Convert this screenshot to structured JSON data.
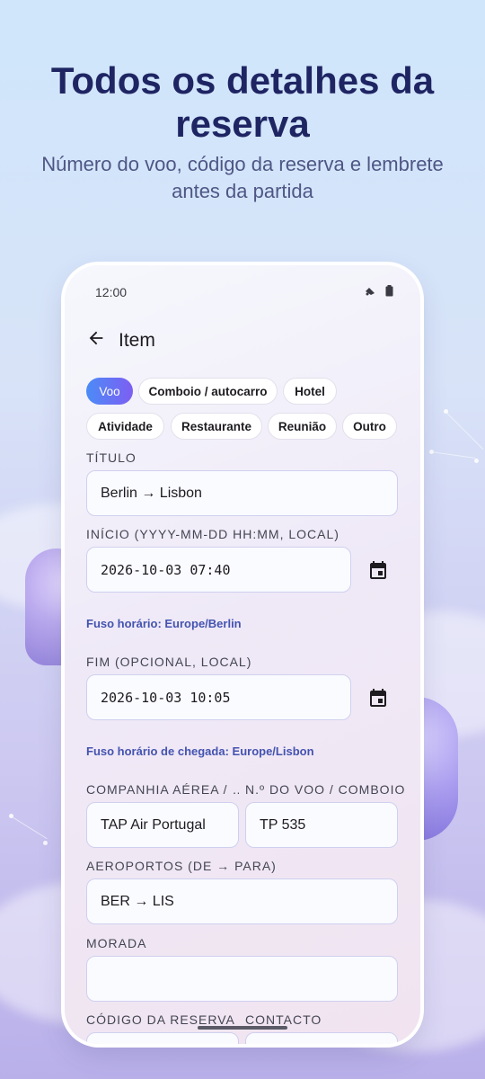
{
  "promo": {
    "headline": "Todos os detalhes da reserva",
    "subline": "Número do voo, código da reserva e lembrete antes da partida"
  },
  "status_bar": {
    "time": "12:00",
    "icons": [
      "signal-icon",
      "battery-icon"
    ]
  },
  "app_bar": {
    "back_icon": "arrow-back-icon",
    "title": "Item"
  },
  "categories": {
    "selected": "Voo",
    "items": [
      "Voo",
      "Comboio / autocarro",
      "Hotel",
      "Atividade",
      "Restaurante",
      "Reunião",
      "Outro"
    ]
  },
  "form": {
    "title": {
      "label": "TÍTULO",
      "value": "Berlin → Lisbon"
    },
    "start": {
      "label": "INÍCIO (YYYY-MM-DD HH:MM, LOCAL)",
      "value": "2026-10-03 07:40",
      "timezone": "Fuso horário: Europe/Berlin",
      "picker_icon": "calendar-icon"
    },
    "end": {
      "label": "FIM (OPCIONAL, LOCAL)",
      "value": "2026-10-03 10:05",
      "timezone": "Fuso horário de chegada: Europe/Lisbon",
      "picker_icon": "calendar-icon"
    },
    "airline": {
      "label": "COMPANHIA AÉREA / …",
      "value": "TAP Air Portugal"
    },
    "flight_number": {
      "label": "N.º DO VOO / COMBOIO",
      "value": "TP 535"
    },
    "airports": {
      "label": "AEROPORTOS (DE → PARA)",
      "value": "BER → LIS"
    },
    "address": {
      "label": "MORADA",
      "value": ""
    },
    "booking_code": {
      "label": "CÓDIGO DA RESERVA",
      "value": ""
    },
    "contact": {
      "label": "CONTACTO",
      "value": ""
    }
  },
  "colors": {
    "headline": "#1f2563",
    "accent_gradient_start": "#4b8cf7",
    "accent_gradient_end": "#7d5ef2",
    "timezone_text": "#4453b0"
  }
}
